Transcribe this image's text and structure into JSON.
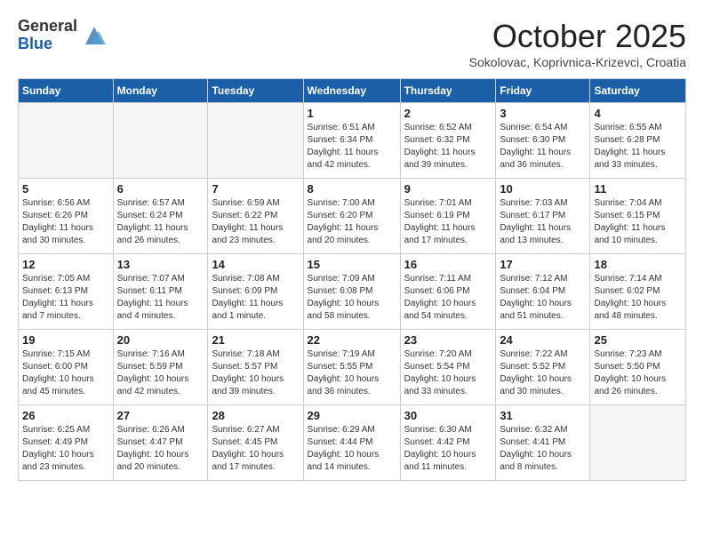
{
  "header": {
    "logo_general": "General",
    "logo_blue": "Blue",
    "month_title": "October 2025",
    "subtitle": "Sokolovac, Koprivnica-Krizevci, Croatia"
  },
  "weekdays": [
    "Sunday",
    "Monday",
    "Tuesday",
    "Wednesday",
    "Thursday",
    "Friday",
    "Saturday"
  ],
  "weeks": [
    [
      {
        "day": "",
        "info": ""
      },
      {
        "day": "",
        "info": ""
      },
      {
        "day": "",
        "info": ""
      },
      {
        "day": "1",
        "info": "Sunrise: 6:51 AM\nSunset: 6:34 PM\nDaylight: 11 hours\nand 42 minutes."
      },
      {
        "day": "2",
        "info": "Sunrise: 6:52 AM\nSunset: 6:32 PM\nDaylight: 11 hours\nand 39 minutes."
      },
      {
        "day": "3",
        "info": "Sunrise: 6:54 AM\nSunset: 6:30 PM\nDaylight: 11 hours\nand 36 minutes."
      },
      {
        "day": "4",
        "info": "Sunrise: 6:55 AM\nSunset: 6:28 PM\nDaylight: 11 hours\nand 33 minutes."
      }
    ],
    [
      {
        "day": "5",
        "info": "Sunrise: 6:56 AM\nSunset: 6:26 PM\nDaylight: 11 hours\nand 30 minutes."
      },
      {
        "day": "6",
        "info": "Sunrise: 6:57 AM\nSunset: 6:24 PM\nDaylight: 11 hours\nand 26 minutes."
      },
      {
        "day": "7",
        "info": "Sunrise: 6:59 AM\nSunset: 6:22 PM\nDaylight: 11 hours\nand 23 minutes."
      },
      {
        "day": "8",
        "info": "Sunrise: 7:00 AM\nSunset: 6:20 PM\nDaylight: 11 hours\nand 20 minutes."
      },
      {
        "day": "9",
        "info": "Sunrise: 7:01 AM\nSunset: 6:19 PM\nDaylight: 11 hours\nand 17 minutes."
      },
      {
        "day": "10",
        "info": "Sunrise: 7:03 AM\nSunset: 6:17 PM\nDaylight: 11 hours\nand 13 minutes."
      },
      {
        "day": "11",
        "info": "Sunrise: 7:04 AM\nSunset: 6:15 PM\nDaylight: 11 hours\nand 10 minutes."
      }
    ],
    [
      {
        "day": "12",
        "info": "Sunrise: 7:05 AM\nSunset: 6:13 PM\nDaylight: 11 hours\nand 7 minutes."
      },
      {
        "day": "13",
        "info": "Sunrise: 7:07 AM\nSunset: 6:11 PM\nDaylight: 11 hours\nand 4 minutes."
      },
      {
        "day": "14",
        "info": "Sunrise: 7:08 AM\nSunset: 6:09 PM\nDaylight: 11 hours\nand 1 minute."
      },
      {
        "day": "15",
        "info": "Sunrise: 7:09 AM\nSunset: 6:08 PM\nDaylight: 10 hours\nand 58 minutes."
      },
      {
        "day": "16",
        "info": "Sunrise: 7:11 AM\nSunset: 6:06 PM\nDaylight: 10 hours\nand 54 minutes."
      },
      {
        "day": "17",
        "info": "Sunrise: 7:12 AM\nSunset: 6:04 PM\nDaylight: 10 hours\nand 51 minutes."
      },
      {
        "day": "18",
        "info": "Sunrise: 7:14 AM\nSunset: 6:02 PM\nDaylight: 10 hours\nand 48 minutes."
      }
    ],
    [
      {
        "day": "19",
        "info": "Sunrise: 7:15 AM\nSunset: 6:00 PM\nDaylight: 10 hours\nand 45 minutes."
      },
      {
        "day": "20",
        "info": "Sunrise: 7:16 AM\nSunset: 5:59 PM\nDaylight: 10 hours\nand 42 minutes."
      },
      {
        "day": "21",
        "info": "Sunrise: 7:18 AM\nSunset: 5:57 PM\nDaylight: 10 hours\nand 39 minutes."
      },
      {
        "day": "22",
        "info": "Sunrise: 7:19 AM\nSunset: 5:55 PM\nDaylight: 10 hours\nand 36 minutes."
      },
      {
        "day": "23",
        "info": "Sunrise: 7:20 AM\nSunset: 5:54 PM\nDaylight: 10 hours\nand 33 minutes."
      },
      {
        "day": "24",
        "info": "Sunrise: 7:22 AM\nSunset: 5:52 PM\nDaylight: 10 hours\nand 30 minutes."
      },
      {
        "day": "25",
        "info": "Sunrise: 7:23 AM\nSunset: 5:50 PM\nDaylight: 10 hours\nand 26 minutes."
      }
    ],
    [
      {
        "day": "26",
        "info": "Sunrise: 6:25 AM\nSunset: 4:49 PM\nDaylight: 10 hours\nand 23 minutes."
      },
      {
        "day": "27",
        "info": "Sunrise: 6:26 AM\nSunset: 4:47 PM\nDaylight: 10 hours\nand 20 minutes."
      },
      {
        "day": "28",
        "info": "Sunrise: 6:27 AM\nSunset: 4:45 PM\nDaylight: 10 hours\nand 17 minutes."
      },
      {
        "day": "29",
        "info": "Sunrise: 6:29 AM\nSunset: 4:44 PM\nDaylight: 10 hours\nand 14 minutes."
      },
      {
        "day": "30",
        "info": "Sunrise: 6:30 AM\nSunset: 4:42 PM\nDaylight: 10 hours\nand 11 minutes."
      },
      {
        "day": "31",
        "info": "Sunrise: 6:32 AM\nSunset: 4:41 PM\nDaylight: 10 hours\nand 8 minutes."
      },
      {
        "day": "",
        "info": ""
      }
    ]
  ]
}
